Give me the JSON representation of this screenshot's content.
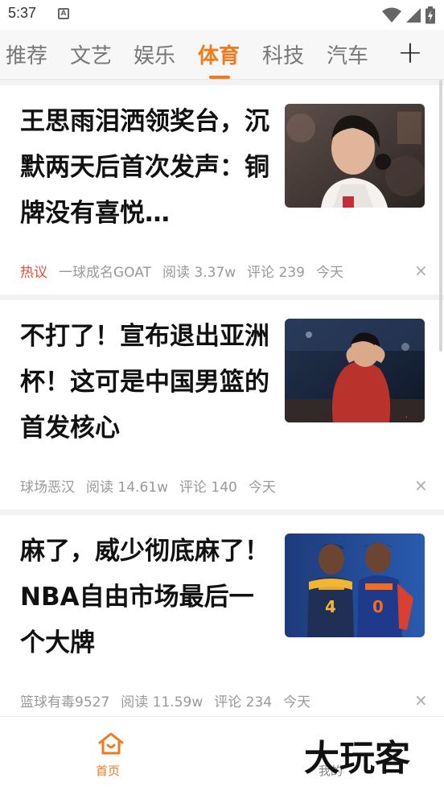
{
  "status_bar": {
    "time": "5:37",
    "notification_icon": "a-icon",
    "icons": [
      "wifi-icon",
      "signal-icon",
      "battery-charging-icon"
    ]
  },
  "tabs": [
    {
      "label": "推荐",
      "active": false
    },
    {
      "label": "文艺",
      "active": false
    },
    {
      "label": "娱乐",
      "active": false
    },
    {
      "label": "体育",
      "active": true
    },
    {
      "label": "科技",
      "active": false
    },
    {
      "label": "汽车",
      "active": false
    }
  ],
  "tab_add_label": "+",
  "articles": [
    {
      "title": "王思雨泪洒领奖台，沉默两天后首次发声：铜牌没有喜悦…",
      "hot_tag": "热议",
      "author": "一球成名GOAT",
      "reads": "阅读 3.37w",
      "comments": "评论 239",
      "time": "今天",
      "thumb": "basketball-player-photo"
    },
    {
      "title": "不打了！宣布退出亚洲杯！这可是中国男篮的首发核心",
      "hot_tag": "",
      "author": "球场恶汉",
      "reads": "阅读 14.61w",
      "comments": "评论 140",
      "time": "今天",
      "thumb": "basketball-player-photo"
    },
    {
      "title": "麻了，威少彻底麻了！NBA自由市场最后一个大牌",
      "hot_tag": "",
      "author": "篮球有毒9527",
      "reads": "阅读 11.59w",
      "comments": "评论 234",
      "time": "今天",
      "thumb": "basketball-players-photo"
    }
  ],
  "close_label": "×",
  "bottom_nav": {
    "home_label": "首页",
    "mine_label": "我的",
    "watermark": "大玩客"
  },
  "colors": {
    "accent": "#f17a1f",
    "hot": "#e94a3b",
    "meta": "#999999"
  }
}
